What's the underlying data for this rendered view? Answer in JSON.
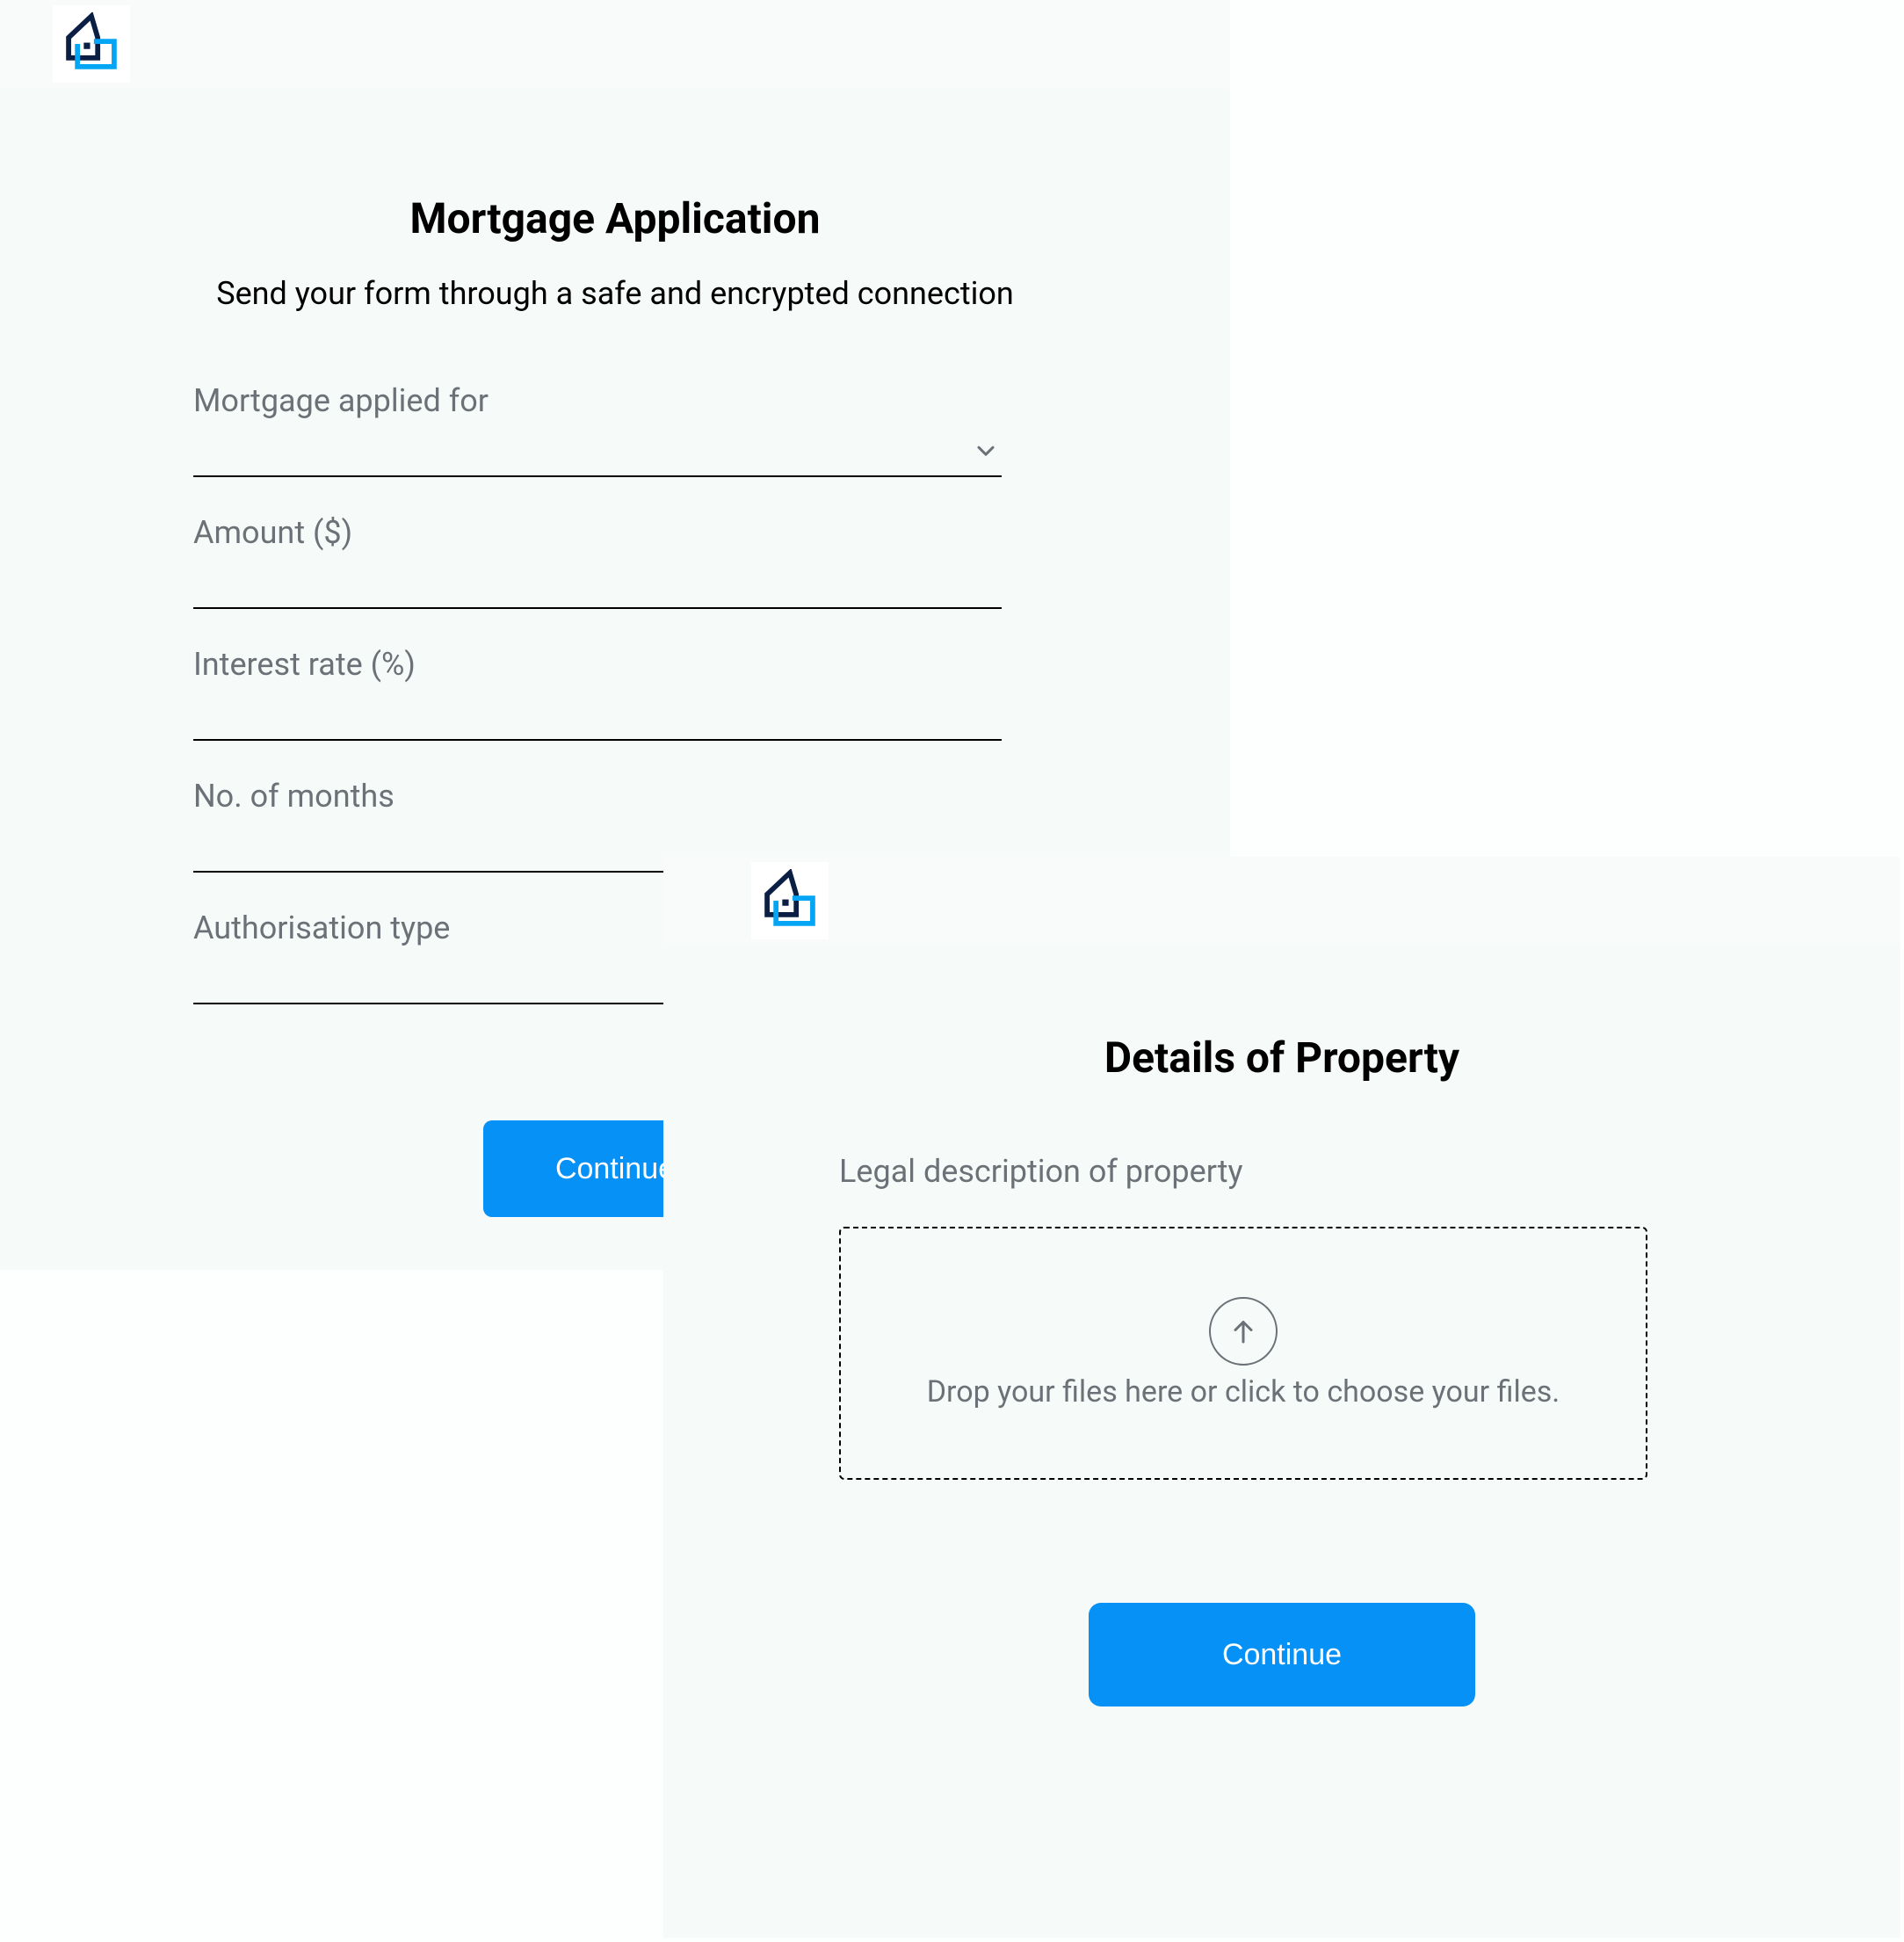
{
  "card1": {
    "title": "Mortgage Application",
    "subtitle": "Send your form through a safe and encrypted connection",
    "fields": {
      "mortgage_applied_for": "Mortgage applied for",
      "amount": "Amount ($)",
      "interest_rate": "Interest rate (%)",
      "no_of_months": "No. of months",
      "authorisation_type": "Authorisation type"
    },
    "continue_label": "Continue"
  },
  "card2": {
    "title": "Details of Property",
    "legal_description_label": "Legal description of property",
    "dropzone_text": "Drop your files here or click to choose your files.",
    "continue_label": "Continue"
  }
}
